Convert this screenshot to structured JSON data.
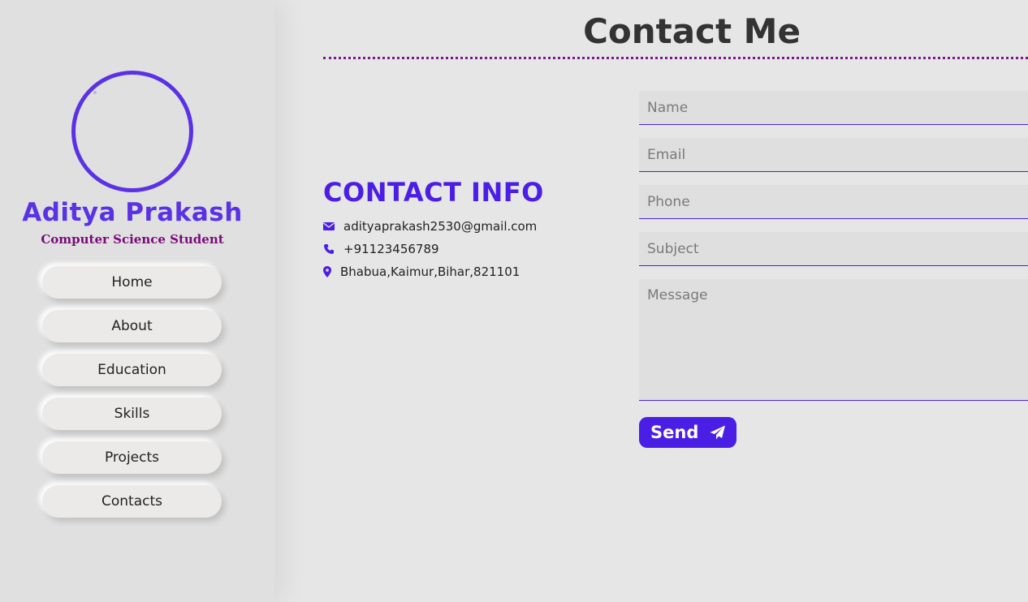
{
  "profile": {
    "name": "Aditya Prakash",
    "role": "Computer Science Student"
  },
  "nav": [
    {
      "label": "Home"
    },
    {
      "label": "About"
    },
    {
      "label": "Education"
    },
    {
      "label": "Skills"
    },
    {
      "label": "Projects"
    },
    {
      "label": "Contacts"
    }
  ],
  "page": {
    "title": "Contact Me"
  },
  "contact_info": {
    "heading": "CONTACT INFO",
    "email": "adityaprakash2530@gmail.com",
    "phone": "+91123456789",
    "address": "Bhabua,Kaimur,Bihar,821101"
  },
  "form": {
    "name_placeholder": "Name",
    "email_placeholder": "Email",
    "phone_placeholder": "Phone",
    "subject_placeholder": "Subject",
    "message_placeholder": "Message",
    "send_label": "Send"
  },
  "colors": {
    "accent": "#4b1ee6",
    "name": "#5a32e6",
    "role": "#7a0a7a",
    "background": "#e6e6e6"
  },
  "icons": [
    "envelope-icon",
    "phone-icon",
    "map-pin-icon",
    "paper-plane-icon"
  ]
}
